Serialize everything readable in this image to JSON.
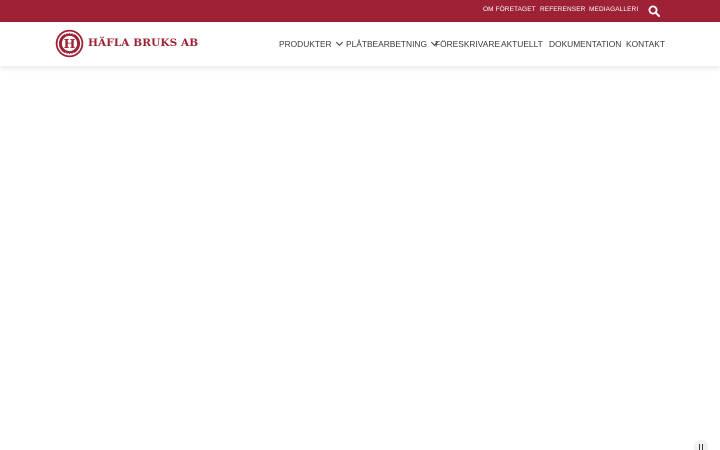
{
  "topbar": {
    "links": [
      "OM FÖRETAGET",
      "REFERENSER",
      "MEDIAGALLERI"
    ],
    "search_icon": "search-icon"
  },
  "logo": {
    "text": "HÄFLA BRUKS AB",
    "emblem_letter": "H"
  },
  "nav": {
    "items": [
      "PRODUKTER",
      "PLÅTBEARBETNING",
      "FÖRESKRIVARE",
      "AKTUELLT",
      "DOKUMENTATION",
      "KONTAKT"
    ]
  },
  "colors": {
    "brand": "#9d2235",
    "nav_text": "#3a3a3a",
    "background": "#ffffff"
  },
  "media_control": {
    "icon": "pause-icon"
  }
}
